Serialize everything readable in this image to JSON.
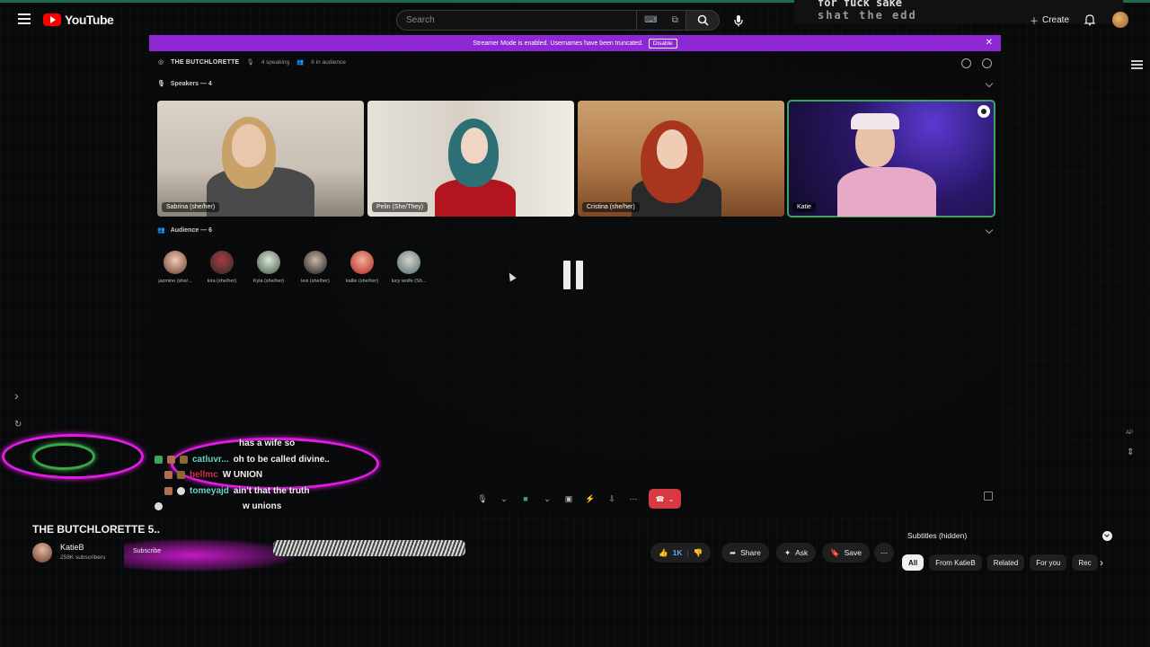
{
  "header": {
    "app_name": "YouTube",
    "search_placeholder": "Search",
    "stream_overlay_line1": "for fuck sake",
    "stream_overlay_line2": "shat    the edd",
    "create_label": "Create"
  },
  "stage": {
    "banner_text": "Streamer Mode is enabled. Usernames have been truncated.",
    "disable_label": "Disable",
    "title": "THE BUTCHLORETTE",
    "speaking_count": "4 speaking",
    "audience_count": "6 in audience",
    "speakers_label": "Speakers — 4",
    "audience_label": "Audience — 6",
    "speakers": [
      {
        "name": "Sabrina (she/her)"
      },
      {
        "name": "Pelin (She/They)"
      },
      {
        "name": "Cristina (she/her)"
      },
      {
        "name": "Katie"
      }
    ],
    "audience": [
      {
        "name": "jazmine (she/..."
      },
      {
        "name": "kira (she/her)"
      },
      {
        "name": "Kyla (she/her)"
      },
      {
        "name": "lexi (she/her)"
      },
      {
        "name": "kallie (she/her)"
      },
      {
        "name": "lucy wolfe (Sh..."
      }
    ]
  },
  "chat": [
    {
      "user": "",
      "message": "has a wife so"
    },
    {
      "user": "catluvr...",
      "message": "oh to be called divine.."
    },
    {
      "user": "bellmc",
      "message": "W UNION"
    },
    {
      "user": "tomeyajd",
      "message": "ain't that the truth"
    },
    {
      "user": "",
      "message": "w unions"
    }
  ],
  "video": {
    "title": "THE BUTCHLORETTE 5..",
    "channel": "KatieB",
    "subscribers": "258K subscribers",
    "subscribe_label": "Subscribe",
    "like_count": "1K",
    "share_label": "Share",
    "ask_label": "Ask",
    "save_label": "Save"
  },
  "sidebar": {
    "subtitles_label": "Subtitles (hidden)",
    "chips": [
      "All",
      "From KatieB",
      "Related",
      "For you",
      "Rec"
    ],
    "ap_label": "AP"
  },
  "colors": {
    "accent_purple": "#8d28d4",
    "speaking_green": "#3ba55c",
    "leave_red": "#d83a42",
    "scribble_magenta": "#e21ce6"
  }
}
